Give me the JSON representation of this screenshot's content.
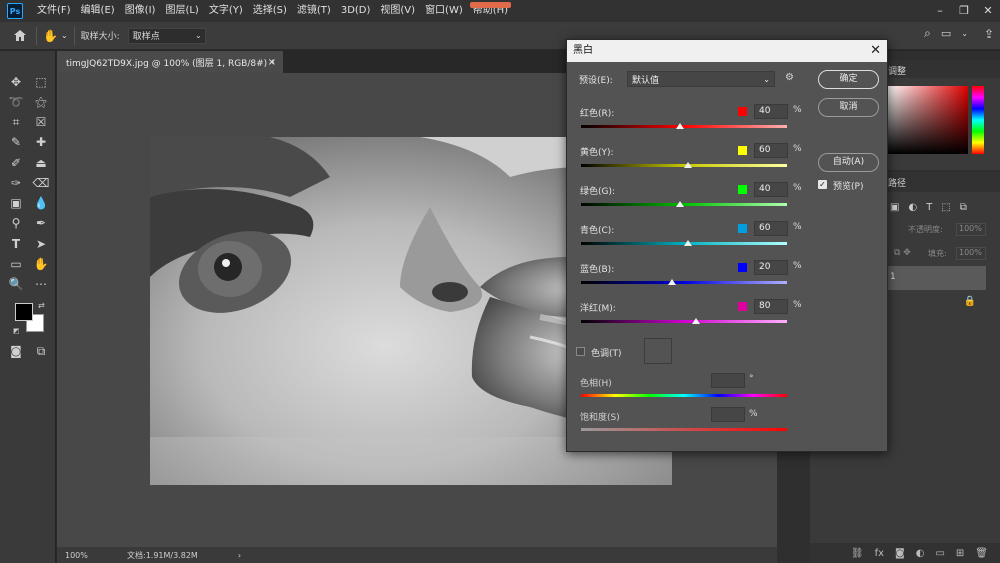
{
  "app": {
    "logo": "Ps"
  },
  "menu": [
    "文件(F)",
    "编辑(E)",
    "图像(I)",
    "图层(L)",
    "文字(Y)",
    "选择(S)",
    "滤镜(T)",
    "3D(D)",
    "视图(V)",
    "窗口(W)",
    "帮助(H)"
  ],
  "window_controls": {
    "minimize": "–",
    "restore": "❐",
    "close": "✕"
  },
  "options_bar": {
    "sample_size_label": "取样大小:",
    "sample_size_value": "取样点"
  },
  "document": {
    "tab_title": "timgJQ62TD9X.jpg @ 100% (图层 1, RGB/8#) *",
    "tab_close": "×",
    "zoom": "100%",
    "doc_info": "文档:1.91M/3.82M",
    "status_arrow": "›"
  },
  "panels": {
    "adjust_tab": "调整",
    "paths_tab": "路径",
    "opacity_label": "不透明度:",
    "opacity_value": "100%",
    "fill_label": "填充:",
    "fill_value": "100%",
    "layer_name": "1"
  },
  "dialog": {
    "title": "黑白",
    "preset_label": "预设(E):",
    "preset_value": "默认值",
    "ok_label": "确定",
    "cancel_label": "取消",
    "auto_label": "自动(A)",
    "preview_label": "预览(P)",
    "preview_checked": true,
    "channels": [
      {
        "label": "红色(R):",
        "value": "40",
        "color": "#ff0000",
        "fraction": 0.48
      },
      {
        "label": "黄色(Y):",
        "value": "60",
        "color": "#ffff00",
        "fraction": 0.52
      },
      {
        "label": "绿色(G):",
        "value": "40",
        "color": "#00ff00",
        "fraction": 0.48
      },
      {
        "label": "青色(C):",
        "value": "60",
        "color": "#00a0e0",
        "fraction": 0.52
      },
      {
        "label": "蓝色(B):",
        "value": "20",
        "color": "#0000ff",
        "fraction": 0.44
      },
      {
        "label": "洋红(M):",
        "value": "80",
        "color": "#e000a0",
        "fraction": 0.56
      }
    ],
    "tint_label": "色调(T)",
    "tint_checked": false,
    "hue_label": "色相(H)",
    "hue_unit": "°",
    "saturation_label": "饱和度(S)",
    "saturation_unit": "%",
    "percent": "%"
  }
}
